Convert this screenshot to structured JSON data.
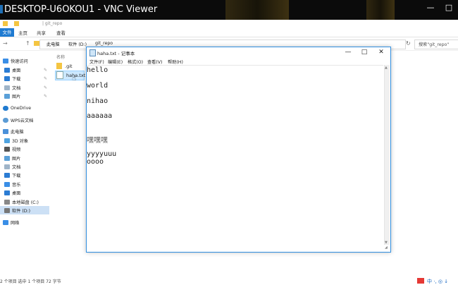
{
  "vnc": {
    "title": "DESKTOP-U6OKOU1 - VNC Viewer",
    "min": "—",
    "max": "□"
  },
  "explorer": {
    "qat_path": "| git_repo",
    "ribbon_tabs": [
      "文件",
      "主页",
      "共享",
      "查看"
    ],
    "breadcrumb": [
      "此电脑",
      "软件 (D:)",
      "git_repo"
    ],
    "search_placeholder": "搜索\"git_repo\"",
    "column_header": "名称",
    "nav": {
      "quick_access": "快速访问",
      "quick_items": [
        "桌面",
        "下载",
        "文档",
        "图片"
      ],
      "onedrive": "OneDrive",
      "wps": "WPS云文档",
      "this_pc": "此电脑",
      "pc_items": [
        "3D 对象",
        "视频",
        "图片",
        "文档",
        "下载",
        "音乐",
        "桌面",
        "本地磁盘 (C:)",
        "软件 (D:)"
      ],
      "network": "网络"
    },
    "files": [
      ".git",
      "haha.txt"
    ],
    "status": "2 个项目    选中 1 个项目  72 字节"
  },
  "notepad": {
    "title": "haha.txt - 记事本",
    "menu": [
      "文件(F)",
      "编辑(E)",
      "格式(O)",
      "查看(V)",
      "帮助(H)"
    ],
    "lines": [
      "hello",
      "world",
      "nihao",
      "aaaaaa",
      "嘿嘿嘿",
      "yyyyuuu",
      "oooo"
    ]
  },
  "tray": {
    "text": "中 ·, ◎ ↓"
  },
  "colors": {
    "accent": "#1e7ad1",
    "selection": "#cce8ff",
    "title_bar": "#0b0b0b"
  }
}
